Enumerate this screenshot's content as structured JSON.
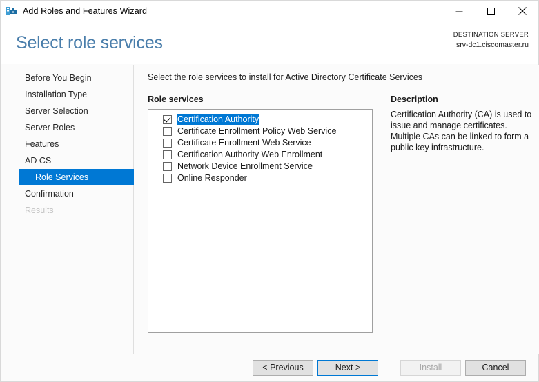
{
  "window": {
    "title": "Add Roles and Features Wizard",
    "icon": "server-manager-icon",
    "controls": {
      "minimize": "minimize-icon",
      "maximize": "maximize-icon",
      "close": "close-icon"
    }
  },
  "header": {
    "page_title": "Select role services",
    "destination_label": "DESTINATION SERVER",
    "destination_server": "srv-dc1.ciscomaster.ru"
  },
  "sidebar": {
    "items": [
      {
        "label": "Before You Begin",
        "state": "normal",
        "sub": false
      },
      {
        "label": "Installation Type",
        "state": "normal",
        "sub": false
      },
      {
        "label": "Server Selection",
        "state": "normal",
        "sub": false
      },
      {
        "label": "Server Roles",
        "state": "normal",
        "sub": false
      },
      {
        "label": "Features",
        "state": "normal",
        "sub": false
      },
      {
        "label": "AD CS",
        "state": "normal",
        "sub": false
      },
      {
        "label": "Role Services",
        "state": "selected",
        "sub": true
      },
      {
        "label": "Confirmation",
        "state": "normal",
        "sub": false
      },
      {
        "label": "Results",
        "state": "disabled",
        "sub": false
      }
    ]
  },
  "main": {
    "instruction": "Select the role services to install for Active Directory Certificate Services",
    "role_services_label": "Role services",
    "role_services": [
      {
        "label": "Certification Authority",
        "checked": true,
        "selected": true
      },
      {
        "label": "Certificate Enrollment Policy Web Service",
        "checked": false,
        "selected": false
      },
      {
        "label": "Certificate Enrollment Web Service",
        "checked": false,
        "selected": false
      },
      {
        "label": "Certification Authority Web Enrollment",
        "checked": false,
        "selected": false
      },
      {
        "label": "Network Device Enrollment Service",
        "checked": false,
        "selected": false
      },
      {
        "label": "Online Responder",
        "checked": false,
        "selected": false
      }
    ],
    "description_title": "Description",
    "description_body": "Certification Authority (CA) is used to issue and manage certificates. Multiple CAs can be linked to form a public key infrastructure."
  },
  "footer": {
    "previous": "< Previous",
    "next": "Next >",
    "install": "Install",
    "cancel": "Cancel",
    "install_enabled": false
  },
  "colors": {
    "accent": "#0078d4",
    "title_blue": "#4a7eab",
    "pane_bg": "#fbfbfb",
    "disabled_text": "#c4c4c4"
  }
}
